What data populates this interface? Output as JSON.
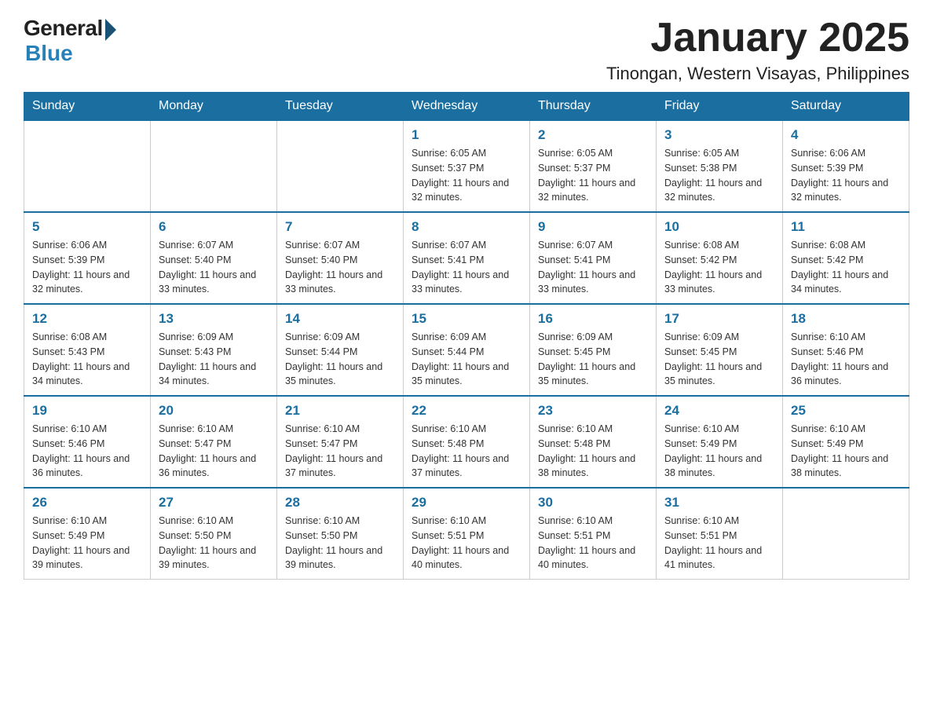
{
  "header": {
    "logo_general": "General",
    "logo_blue": "Blue",
    "month_title": "January 2025",
    "location": "Tinongan, Western Visayas, Philippines"
  },
  "days_of_week": [
    "Sunday",
    "Monday",
    "Tuesday",
    "Wednesday",
    "Thursday",
    "Friday",
    "Saturday"
  ],
  "weeks": [
    [
      {
        "day": "",
        "info": ""
      },
      {
        "day": "",
        "info": ""
      },
      {
        "day": "",
        "info": ""
      },
      {
        "day": "1",
        "info": "Sunrise: 6:05 AM\nSunset: 5:37 PM\nDaylight: 11 hours and 32 minutes."
      },
      {
        "day": "2",
        "info": "Sunrise: 6:05 AM\nSunset: 5:37 PM\nDaylight: 11 hours and 32 minutes."
      },
      {
        "day": "3",
        "info": "Sunrise: 6:05 AM\nSunset: 5:38 PM\nDaylight: 11 hours and 32 minutes."
      },
      {
        "day": "4",
        "info": "Sunrise: 6:06 AM\nSunset: 5:39 PM\nDaylight: 11 hours and 32 minutes."
      }
    ],
    [
      {
        "day": "5",
        "info": "Sunrise: 6:06 AM\nSunset: 5:39 PM\nDaylight: 11 hours and 32 minutes."
      },
      {
        "day": "6",
        "info": "Sunrise: 6:07 AM\nSunset: 5:40 PM\nDaylight: 11 hours and 33 minutes."
      },
      {
        "day": "7",
        "info": "Sunrise: 6:07 AM\nSunset: 5:40 PM\nDaylight: 11 hours and 33 minutes."
      },
      {
        "day": "8",
        "info": "Sunrise: 6:07 AM\nSunset: 5:41 PM\nDaylight: 11 hours and 33 minutes."
      },
      {
        "day": "9",
        "info": "Sunrise: 6:07 AM\nSunset: 5:41 PM\nDaylight: 11 hours and 33 minutes."
      },
      {
        "day": "10",
        "info": "Sunrise: 6:08 AM\nSunset: 5:42 PM\nDaylight: 11 hours and 33 minutes."
      },
      {
        "day": "11",
        "info": "Sunrise: 6:08 AM\nSunset: 5:42 PM\nDaylight: 11 hours and 34 minutes."
      }
    ],
    [
      {
        "day": "12",
        "info": "Sunrise: 6:08 AM\nSunset: 5:43 PM\nDaylight: 11 hours and 34 minutes."
      },
      {
        "day": "13",
        "info": "Sunrise: 6:09 AM\nSunset: 5:43 PM\nDaylight: 11 hours and 34 minutes."
      },
      {
        "day": "14",
        "info": "Sunrise: 6:09 AM\nSunset: 5:44 PM\nDaylight: 11 hours and 35 minutes."
      },
      {
        "day": "15",
        "info": "Sunrise: 6:09 AM\nSunset: 5:44 PM\nDaylight: 11 hours and 35 minutes."
      },
      {
        "day": "16",
        "info": "Sunrise: 6:09 AM\nSunset: 5:45 PM\nDaylight: 11 hours and 35 minutes."
      },
      {
        "day": "17",
        "info": "Sunrise: 6:09 AM\nSunset: 5:45 PM\nDaylight: 11 hours and 35 minutes."
      },
      {
        "day": "18",
        "info": "Sunrise: 6:10 AM\nSunset: 5:46 PM\nDaylight: 11 hours and 36 minutes."
      }
    ],
    [
      {
        "day": "19",
        "info": "Sunrise: 6:10 AM\nSunset: 5:46 PM\nDaylight: 11 hours and 36 minutes."
      },
      {
        "day": "20",
        "info": "Sunrise: 6:10 AM\nSunset: 5:47 PM\nDaylight: 11 hours and 36 minutes."
      },
      {
        "day": "21",
        "info": "Sunrise: 6:10 AM\nSunset: 5:47 PM\nDaylight: 11 hours and 37 minutes."
      },
      {
        "day": "22",
        "info": "Sunrise: 6:10 AM\nSunset: 5:48 PM\nDaylight: 11 hours and 37 minutes."
      },
      {
        "day": "23",
        "info": "Sunrise: 6:10 AM\nSunset: 5:48 PM\nDaylight: 11 hours and 38 minutes."
      },
      {
        "day": "24",
        "info": "Sunrise: 6:10 AM\nSunset: 5:49 PM\nDaylight: 11 hours and 38 minutes."
      },
      {
        "day": "25",
        "info": "Sunrise: 6:10 AM\nSunset: 5:49 PM\nDaylight: 11 hours and 38 minutes."
      }
    ],
    [
      {
        "day": "26",
        "info": "Sunrise: 6:10 AM\nSunset: 5:49 PM\nDaylight: 11 hours and 39 minutes."
      },
      {
        "day": "27",
        "info": "Sunrise: 6:10 AM\nSunset: 5:50 PM\nDaylight: 11 hours and 39 minutes."
      },
      {
        "day": "28",
        "info": "Sunrise: 6:10 AM\nSunset: 5:50 PM\nDaylight: 11 hours and 39 minutes."
      },
      {
        "day": "29",
        "info": "Sunrise: 6:10 AM\nSunset: 5:51 PM\nDaylight: 11 hours and 40 minutes."
      },
      {
        "day": "30",
        "info": "Sunrise: 6:10 AM\nSunset: 5:51 PM\nDaylight: 11 hours and 40 minutes."
      },
      {
        "day": "31",
        "info": "Sunrise: 6:10 AM\nSunset: 5:51 PM\nDaylight: 11 hours and 41 minutes."
      },
      {
        "day": "",
        "info": ""
      }
    ]
  ]
}
